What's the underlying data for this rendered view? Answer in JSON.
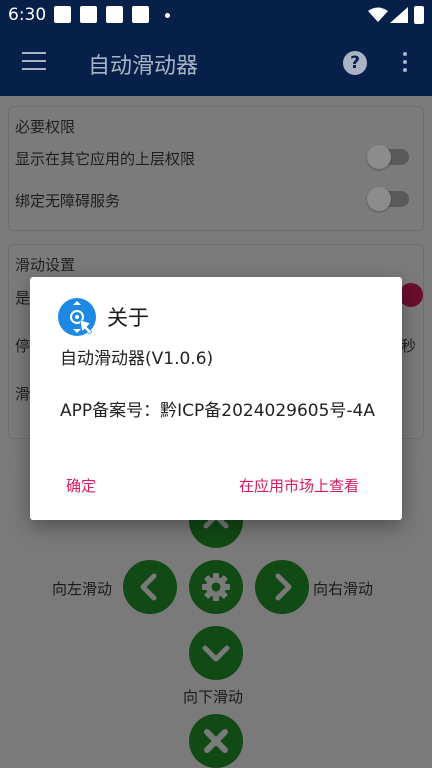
{
  "status_bar": {
    "time": "6:30"
  },
  "app_bar": {
    "title": "自动滑动器",
    "menu_icon": "hamburger-menu-icon",
    "help_icon": "help-icon",
    "more_icon": "more-vert-icon"
  },
  "permissions_card": {
    "title": "必要权限",
    "overlay_label": "显示在其它应用的上层权限",
    "accessibility_label": "绑定无障碍服务"
  },
  "swipe_card": {
    "title": "滑动设置",
    "row1_partial": "是",
    "row2_partial": "停",
    "row2_suffix": "秒",
    "row3_partial": "滑"
  },
  "control_pad": {
    "left_label": "向左滑动",
    "right_label": "向右滑动",
    "down_label": "向下滑动"
  },
  "dialog": {
    "title": "关于",
    "version_line": "自动滑动器(V1.0.6)",
    "icp_line": "APP备案号：黔ICP备2024029605号-4A",
    "confirm_button": "确定",
    "market_button": "在应用市场上查看"
  },
  "colors": {
    "app_bar": "#07204a",
    "accent": "#d81b60",
    "pad_button": "#114a14"
  }
}
